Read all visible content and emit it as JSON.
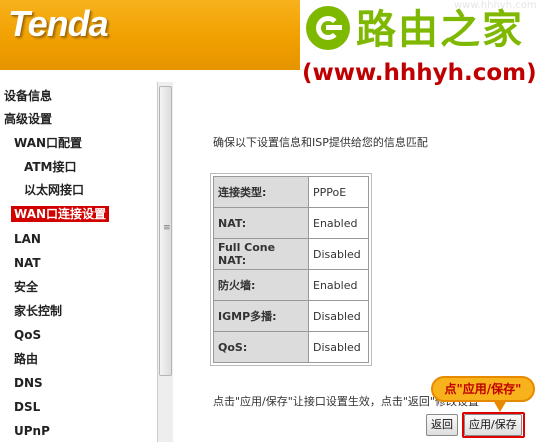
{
  "header": {
    "logo": "Tenda"
  },
  "watermark": {
    "title": "路由之家",
    "url": "(www.hhhyh.com)",
    "faint": "www.hhhyh.com",
    "brand_color": "#7fb800",
    "url_color": "#c00000"
  },
  "sidebar": {
    "items": [
      {
        "label": "设备信息"
      },
      {
        "label": "高级设置"
      },
      {
        "label": "WAN口配置"
      },
      {
        "label": "ATM接口"
      },
      {
        "label": "以太网接口"
      },
      {
        "label": "WAN口连接设置"
      },
      {
        "label": "LAN"
      },
      {
        "label": "NAT"
      },
      {
        "label": "安全"
      },
      {
        "label": "家长控制"
      },
      {
        "label": "QoS"
      },
      {
        "label": "路由"
      },
      {
        "label": "DNS"
      },
      {
        "label": "DSL"
      },
      {
        "label": "UPnP"
      }
    ],
    "active_index": 5,
    "active_color": "#d30000",
    "scroll_grip": "≡"
  },
  "main": {
    "intro": "确保以下设置信息和ISP提供给您的信息匹配",
    "rows": [
      {
        "label": "连接类型:",
        "value": "PPPoE"
      },
      {
        "label": "NAT:",
        "value": "Enabled"
      },
      {
        "label": "Full Cone NAT:",
        "value": "Disabled"
      },
      {
        "label": "防火墙:",
        "value": "Enabled"
      },
      {
        "label": "IGMP多播:",
        "value": "Disabled"
      },
      {
        "label": "QoS:",
        "value": "Disabled"
      }
    ],
    "note": "点击\"应用/保存\"让接口设置生效，点击\"返回\"修改设置",
    "back_label": "返回",
    "apply_label": "应用/保存",
    "callout": "点\"应用/保存\""
  }
}
